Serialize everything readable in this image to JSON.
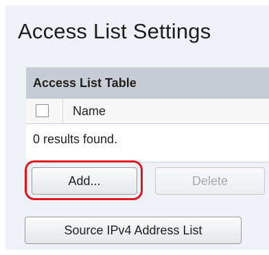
{
  "page": {
    "title": "Access List Settings"
  },
  "access_list_table": {
    "caption": "Access List Table",
    "columns": [
      "Name"
    ],
    "results_text": "0 results found."
  },
  "buttons": {
    "add_label": "Add...",
    "delete_label": "Delete",
    "source_label": "Source IPv4 Address List"
  },
  "colors": {
    "highlight": "#e0141e",
    "caption_bg": "#c7ccd5",
    "page_bg": "#eef1f6"
  }
}
